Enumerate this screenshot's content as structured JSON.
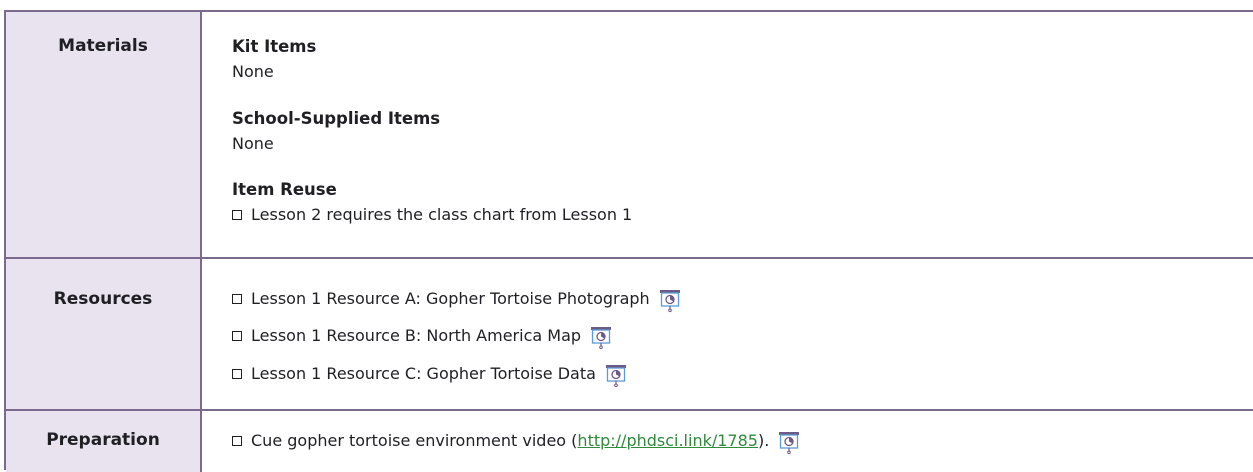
{
  "materials": {
    "label": "Materials",
    "kit_items": {
      "heading": "Kit Items",
      "value": "None"
    },
    "school_supplied": {
      "heading": "School-Supplied Items",
      "value": "None"
    },
    "item_reuse": {
      "heading": "Item Reuse",
      "items": [
        "Lesson 2 requires the class chart from Lesson 1"
      ]
    }
  },
  "resources": {
    "label": "Resources",
    "items": [
      {
        "text": "Lesson 1 Resource A: Gopher Tortoise Photograph",
        "icon": "projector-icon"
      },
      {
        "text": "Lesson 1 Resource B: North America Map",
        "icon": "projector-icon"
      },
      {
        "text": "Lesson 1 Resource C: Gopher Tortoise Data",
        "icon": "projector-icon"
      }
    ]
  },
  "preparation": {
    "label": "Preparation",
    "item": {
      "prefix": "Cue gopher tortoise environment video (",
      "link": "http://phdsci.link/1785",
      "suffix": ").",
      "icon": "projector-icon"
    }
  },
  "colors": {
    "border": "#7c6a8e",
    "label_background": "#e9e3ef",
    "icon_purple": "#6e5a86",
    "icon_blue": "#5b9bd5",
    "link_green": "#2f8a3d"
  }
}
